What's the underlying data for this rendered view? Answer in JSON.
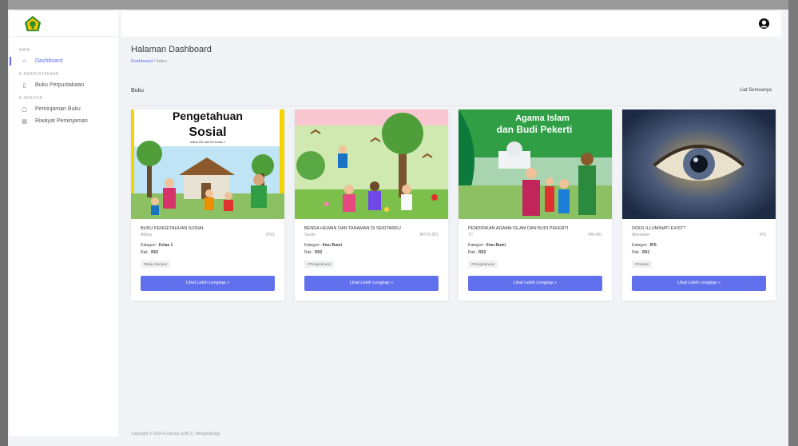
{
  "sidebar": {
    "sections": [
      {
        "title": "MAIN",
        "items": [
          {
            "label": "Dashboard",
            "icon": "home-icon",
            "active": true
          }
        ]
      },
      {
        "title": "E-PERPUSTAKAAN",
        "items": [
          {
            "label": "Buku Perpustakaan",
            "icon": "book-icon"
          }
        ]
      },
      {
        "title": "E-SERVICE",
        "items": [
          {
            "label": "Peminjaman Buku",
            "icon": "borrow-icon"
          },
          {
            "label": "Riwayat Peminjaman",
            "icon": "history-icon"
          }
        ]
      }
    ]
  },
  "page": {
    "title": "Halaman Dashboard",
    "breadcrumb": {
      "link": "Dashboard",
      "separator": "/",
      "current": "Index"
    }
  },
  "books_section": {
    "title": "Buku",
    "see_all": "Liat Semuanya"
  },
  "books": [
    {
      "title": "BUKU PENGETAHUAN SOSIAL",
      "author": "Aditya",
      "subject": "IPS1",
      "category_label": "Kategori :",
      "category": "Kelas 1",
      "rack_label": "Rak :",
      "rack": "R02",
      "tag": "#Buku Bacaan",
      "button": "Lihat Lebih Lengkap"
    },
    {
      "title": "BENDA HEWAN DAN TANAMAN DI SEKITARKU",
      "author": "Susilo",
      "subject": "BHTS-001",
      "category_label": "Kategori :",
      "category": "Ilmu Bumi",
      "rack_label": "Rak :",
      "rack": "R02",
      "tag": "#Pengetahuan",
      "button": "Lihat Lebih Lengkap"
    },
    {
      "title": "PENDIDIKAN AGAMA ISLAM DAN BUDI PEKERTI",
      "author": "Tri",
      "subject": "PAI-001",
      "category_label": "Kategori :",
      "category": "Ilmu Bumi",
      "rack_label": "Rak :",
      "rack": "R02",
      "tag": "#Pengetahuan",
      "button": "Lihat Lebih Lengkap"
    },
    {
      "title": "DOES ILLUMINATI EXIST?",
      "author": "Alexander",
      "subject": "IPS",
      "category_label": "Kategori :",
      "category": "IPS",
      "rack_label": "Rak :",
      "rack": "R01",
      "tag": "#Fantasi",
      "button": "Lihat Lebih Lengkap"
    }
  ],
  "covers": {
    "cover1_line1": "Pengetahuan",
    "cover1_line2": "Sosial",
    "cover1_sub": "untuk SD dan MI Kelas 1",
    "cover3_line1": "Agama Islam",
    "cover3_line2": "dan Budi Pekerti"
  },
  "footer": "Copyright © 2024 E-Library SDN 1 | Menghubungi",
  "colors": {
    "accent": "#5d6cf0",
    "button": "#6171ee"
  }
}
